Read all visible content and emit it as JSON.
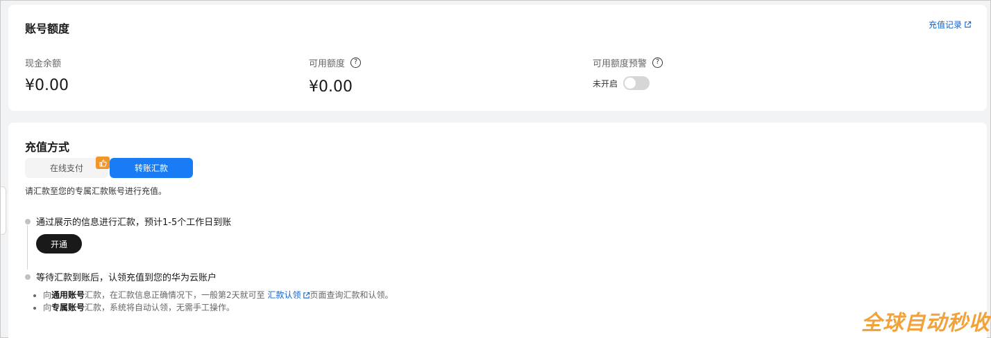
{
  "balance_card": {
    "title": "账号额度",
    "history_link": "充值记录",
    "cash_balance": {
      "label": "现金余额",
      "value": "¥0.00"
    },
    "available_quota": {
      "label": "可用额度",
      "value": "¥0.00",
      "help": "?"
    },
    "quota_alert": {
      "label": "可用额度预警",
      "help": "?",
      "status_text": "未开启",
      "enabled": false
    }
  },
  "recharge_card": {
    "title": "充值方式",
    "tabs": [
      {
        "label": "在线支付",
        "active": false,
        "badge_icon": "thumbs-up-icon"
      },
      {
        "label": "转账汇款",
        "active": true
      }
    ],
    "hint": "请汇款至您的专属汇款账号进行充值。",
    "steps": [
      {
        "text": "通过展示的信息进行汇款，预计1-5个工作日到账",
        "button": "开通"
      },
      {
        "text": "等待汇款到账后，认领充值到您的华为云账户"
      }
    ],
    "notes": [
      {
        "prefix": "向",
        "bold": "通用账号",
        "middle": "汇款，在汇款信息正确情况下，一般第2天就可至 ",
        "link": "汇款认领",
        "suffix": "页面查询汇款和认领。"
      },
      {
        "prefix": "向",
        "bold": "专属账号",
        "middle": "汇款，系统将自动认领，无需手工操作。"
      }
    ]
  },
  "watermark": "全球自动秒收",
  "colors": {
    "accent": "#1a7cf5",
    "link": "#1060c8",
    "badge": "#f3962a",
    "button_dark": "#191919"
  }
}
